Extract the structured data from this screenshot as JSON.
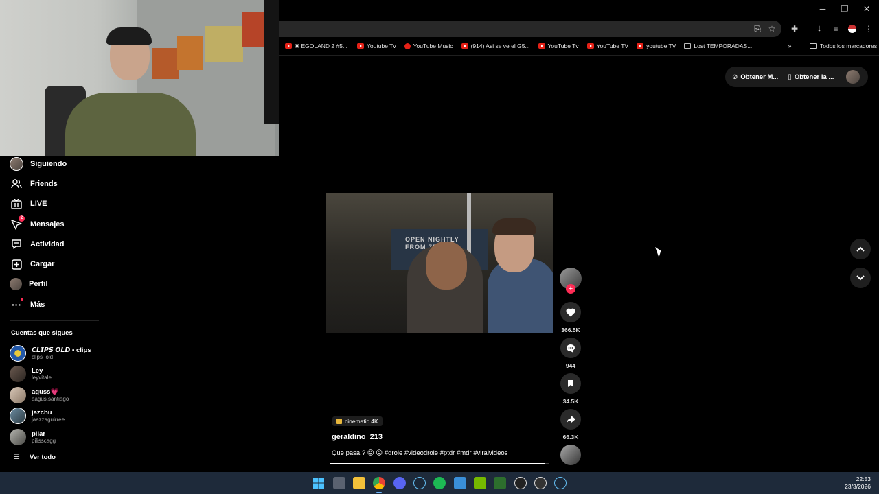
{
  "window": {
    "minimize": "─",
    "maximize": "❐",
    "close": "✕"
  },
  "toolbar": {
    "icons": [
      "install-app-icon",
      "star-icon",
      "extensions-icon",
      "download-icon",
      "media-control-icon",
      "profile-icon",
      "menu-icon"
    ]
  },
  "bookmarks": {
    "items": [
      {
        "label": "✖ EGOLAND 2 #5...",
        "icon": "yt"
      },
      {
        "label": "Youtube Tv",
        "icon": "yt"
      },
      {
        "label": "YouTube Music",
        "icon": "ytm"
      },
      {
        "label": "(914) Asi se ve el G5...",
        "icon": "yt"
      },
      {
        "label": "YouTube Tv",
        "icon": "yt"
      },
      {
        "label": "YouTube TV",
        "icon": "yt"
      },
      {
        "label": "youtube TV",
        "icon": "yt"
      },
      {
        "label": "Lost TEMPORADAS...",
        "icon": "gen"
      }
    ],
    "more": "»",
    "all_label": "Todos los marcadores"
  },
  "sidebar": {
    "nav": [
      {
        "label": "Siguiendo",
        "icon": "avatar-icon"
      },
      {
        "label": "Friends",
        "icon": "friends-icon"
      },
      {
        "label": "LIVE",
        "icon": "live-icon"
      },
      {
        "label": "Mensajes",
        "icon": "messages-icon",
        "badge": "2"
      },
      {
        "label": "Actividad",
        "icon": "activity-icon"
      },
      {
        "label": "Cargar",
        "icon": "upload-icon"
      },
      {
        "label": "Perfil",
        "icon": "profile-avatar-icon"
      },
      {
        "label": "Más",
        "icon": "more-icon"
      }
    ],
    "following_title": "Cuentas que sigues",
    "accounts": [
      {
        "name": "𝘾𝙇𝙄𝙋𝙎 𝙊𝙇𝘿 • clips",
        "handle": "clips_old"
      },
      {
        "name": "Ley",
        "handle": "leyvitale"
      },
      {
        "name": "aguss💗",
        "handle": "aagus.santiago"
      },
      {
        "name": "jazchu",
        "handle": "jaazzaguirree"
      },
      {
        "name": "pilar",
        "handle": "pilisscagg"
      }
    ],
    "see_all": "Ver todo"
  },
  "top_pill": {
    "get_m": "Obtener M...",
    "get_app": "Obtener la ..."
  },
  "video": {
    "sign_text": "OPEN NIGHTLY\nFROM 7PM",
    "music_tag": "cinematic 4K",
    "author": "geraldino_213",
    "description": "Que pasa!? 😝 😝 #drole #videodrole #ptdr #mdr #viralvideos",
    "progress": 0.98
  },
  "actions": {
    "likes": "366.5K",
    "comments": "944",
    "saves": "34.5K",
    "shares": "66.3K",
    "follow_plus": "+"
  },
  "nav_arrows": {
    "up": "⌃",
    "down": "⌄"
  },
  "taskbar": {
    "time": "22:53",
    "date": "23/3/2026",
    "apps": [
      "windows-start-icon",
      "task-view-icon",
      "file-explorer-icon",
      "chrome-icon",
      "discord-icon",
      "steam-icon",
      "spotify-icon",
      "notepad-icon",
      "nvidia-icon",
      "cpuz-icon",
      "obs-icon",
      "ghost-icon",
      "steam-alt-icon"
    ]
  },
  "colors": {
    "accent": "#fe2c55",
    "taskbar": "#1e2a3a",
    "music_tag": "#e8b73c"
  }
}
